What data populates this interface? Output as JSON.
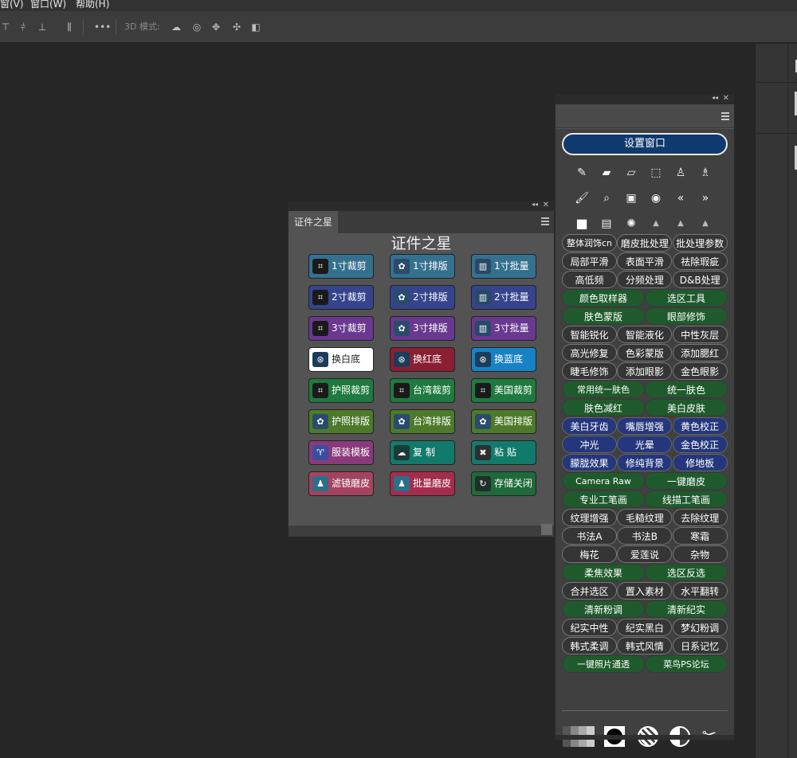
{
  "menubar": {
    "items": [
      "窗(V)",
      "窗口(W)",
      "帮助(H)"
    ]
  },
  "optionsbar": {
    "more_label": "•••",
    "mode_label": "3D 模式:"
  },
  "zjzx_panel": {
    "tab_label": "证件之星",
    "title": "证件之星",
    "buttons": [
      {
        "label": "1寸裁剪",
        "icon": "crop-icon",
        "color": "#36708f"
      },
      {
        "label": "1寸排版",
        "icon": "flower-icon",
        "color": "#36708f"
      },
      {
        "label": "1寸批量",
        "icon": "chart-icon",
        "color": "#36708f"
      },
      {
        "label": "2寸裁剪",
        "icon": "crop-icon",
        "color": "#35448c"
      },
      {
        "label": "2寸排版",
        "icon": "flower-icon",
        "color": "#35448c"
      },
      {
        "label": "2寸批量",
        "icon": "chart-icon",
        "color": "#35448c"
      },
      {
        "label": "3寸裁剪",
        "icon": "crop-icon",
        "color": "#6a3890"
      },
      {
        "label": "3寸排版",
        "icon": "flower-icon",
        "color": "#6a3890"
      },
      {
        "label": "3寸批量",
        "icon": "chart-icon",
        "color": "#6a3890"
      },
      {
        "label": "换白底",
        "icon": "swap-icon",
        "color": "#ffffff",
        "text": "#222222"
      },
      {
        "label": "换红底",
        "icon": "swap-icon",
        "color": "#8a1f33"
      },
      {
        "label": "换蓝底",
        "icon": "swap-icon",
        "color": "#1982c4"
      },
      {
        "label": "护照裁剪",
        "icon": "crop-icon",
        "color": "#1f7a3f"
      },
      {
        "label": "台湾裁剪",
        "icon": "crop-icon",
        "color": "#1f7a3f"
      },
      {
        "label": "美国裁剪",
        "icon": "crop-icon",
        "color": "#1f7a3f"
      },
      {
        "label": "护照排版",
        "icon": "flower-icon",
        "color": "#4d7a2a"
      },
      {
        "label": "台湾排版",
        "icon": "flower-icon",
        "color": "#4d7a2a"
      },
      {
        "label": "美国排版",
        "icon": "flower-icon",
        "color": "#4d7a2a"
      },
      {
        "label": "服装模板",
        "icon": "shirt-icon",
        "color": "#8a3a7a"
      },
      {
        "label": "复  制",
        "icon": "copy-icon",
        "color": "#127a6a"
      },
      {
        "label": "粘  贴",
        "icon": "paste-icon",
        "color": "#127a6a"
      },
      {
        "label": "滤镜磨皮",
        "icon": "person-icon",
        "color": "#a44360"
      },
      {
        "label": "批量磨皮",
        "icon": "person-icon",
        "color": "#a42d4d"
      },
      {
        "label": "存储关闭",
        "icon": "save-close-icon",
        "color": "#1f6a3a"
      }
    ]
  },
  "tool_panel": {
    "settings_button": "设置窗口",
    "tool_rows": [
      [
        "heal-brush-icon",
        "bandage-icon",
        "patch-icon",
        "select-rect-icon",
        "stamp-icon",
        "stamp-pattern-icon"
      ],
      [
        "brush-icon",
        "zoom-icon",
        "frame-icon",
        "eye-icon",
        "prev-icon",
        "next-icon"
      ],
      [
        "square-icon",
        "gradient-icon",
        "splash-icon",
        "histogram-low-icon",
        "histogram-mid-icon",
        "histogram-high-icon"
      ]
    ],
    "rows": [
      {
        "style": "gray",
        "items": [
          "整体润饰cn",
          "磨皮批处理",
          "批处理参数"
        ]
      },
      {
        "style": "gray",
        "items": [
          "局部平滑",
          "表面平滑",
          "祛除瑕疵"
        ]
      },
      {
        "style": "gray",
        "items": [
          "高低频",
          "分频处理",
          "D&B处理"
        ]
      },
      {
        "style": "green",
        "items": [
          "颜色取样器",
          "选区工具"
        ]
      },
      {
        "style": "green",
        "items": [
          "肤色蒙版",
          "眼部修饰"
        ]
      },
      {
        "style": "gray",
        "items": [
          "智能锐化",
          "智能液化",
          "中性灰层"
        ]
      },
      {
        "style": "gray",
        "items": [
          "高光修复",
          "色彩蒙版",
          "添加腮红"
        ]
      },
      {
        "style": "gray",
        "items": [
          "睫毛修饰",
          "添加眼影",
          "金色眼影"
        ]
      },
      {
        "style": "green",
        "items": [
          "常用统一肤色",
          "统一肤色"
        ]
      },
      {
        "style": "green",
        "items": [
          "肤色减红",
          "美白皮肤"
        ]
      },
      {
        "style": "blue",
        "items": [
          "美白牙齿",
          "嘴唇增强",
          "黄色校正"
        ]
      },
      {
        "style": "blue",
        "items": [
          "冲光",
          "光晕",
          "金色校正"
        ]
      },
      {
        "style": "blue",
        "items": [
          "朦胧效果",
          "修纯背景",
          "修地板"
        ]
      },
      {
        "style": "green",
        "items": [
          "Camera Raw",
          "一键磨皮"
        ]
      },
      {
        "style": "green",
        "items": [
          "专业工笔画",
          "线描工笔画"
        ]
      },
      {
        "style": "gray",
        "items": [
          "纹理增强",
          "毛糙纹理",
          "去除纹理"
        ]
      },
      {
        "style": "gray",
        "items": [
          "书法A",
          "书法B",
          "寒霜"
        ]
      },
      {
        "style": "gray",
        "items": [
          "梅花",
          "爱莲说",
          "杂物"
        ]
      },
      {
        "style": "green",
        "items": [
          "柔焦效果",
          "选区反选"
        ]
      },
      {
        "style": "gray",
        "items": [
          "合并选区",
          "置入素材",
          "水平翻转"
        ]
      },
      {
        "style": "green",
        "items": [
          "清新粉调",
          "清新纪实"
        ]
      },
      {
        "style": "gray",
        "items": [
          "纪实中性",
          "纪实黑白",
          "梦幻粉调"
        ]
      },
      {
        "style": "gray",
        "items": [
          "韩式柔调",
          "韩式风情",
          "日系记忆"
        ]
      },
      {
        "style": "green",
        "items": [
          "一键照片通透",
          "菜鸟PS论坛"
        ]
      }
    ],
    "footer_icons": [
      "grayscale-steps-icon",
      "black-circle-icon",
      "stripe-circle-icon",
      "half-circle-icon",
      "tools-icon"
    ]
  }
}
